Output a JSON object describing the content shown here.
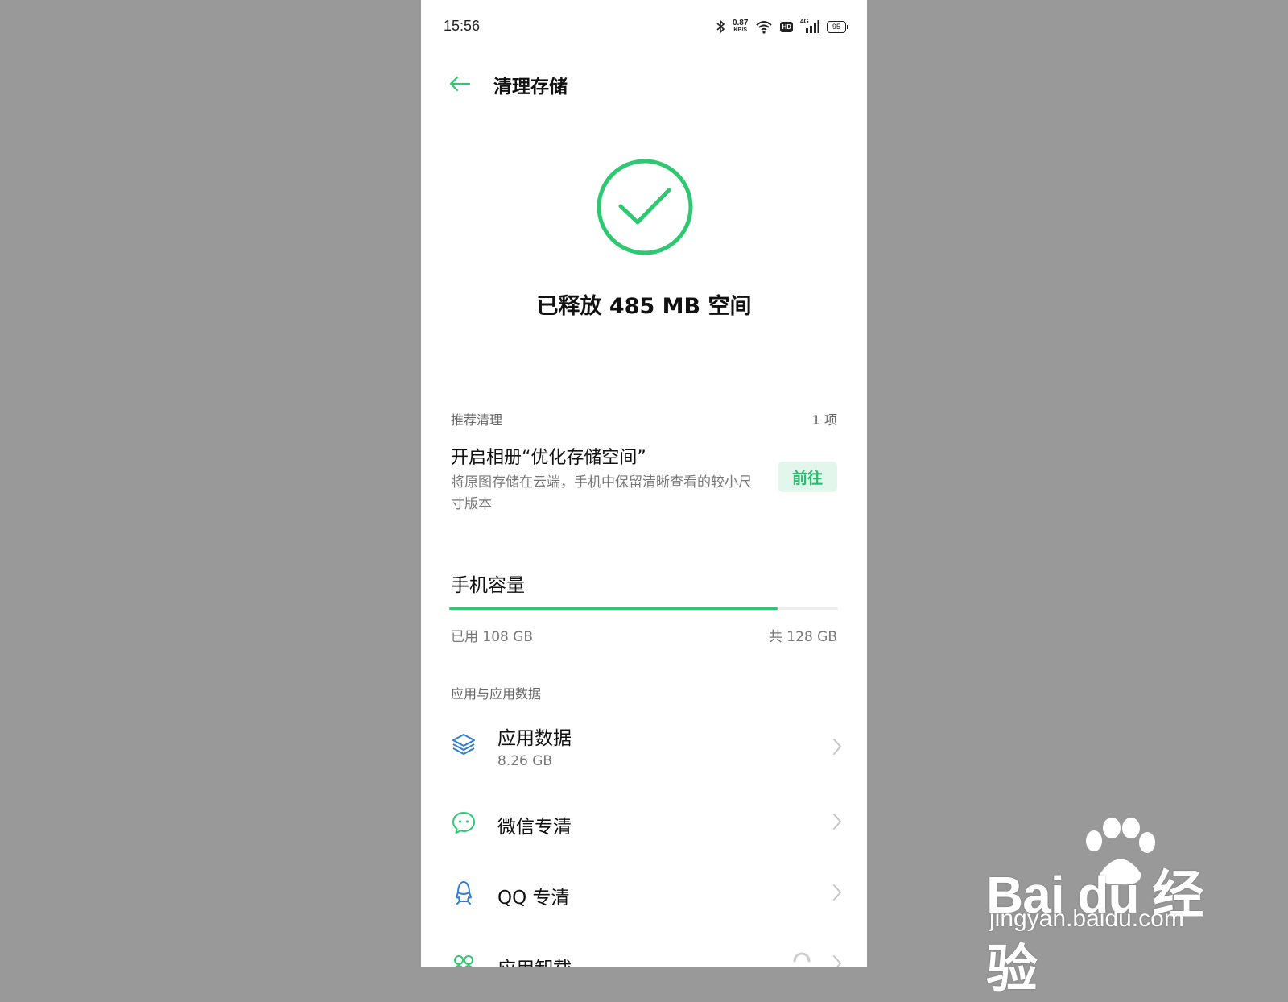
{
  "status_bar": {
    "time": "15:56",
    "net_speed_value": "0.87",
    "net_speed_unit": "KB/S",
    "hd_label": "HD",
    "network_type": "4G",
    "battery": "95",
    "icons": [
      "bluetooth-icon",
      "wifi-icon",
      "hd-icon",
      "signal-4g-icon",
      "battery-icon"
    ]
  },
  "header": {
    "back_icon": "back-arrow-icon",
    "title": "清理存储"
  },
  "result": {
    "icon": "check-circle-icon",
    "message": "已释放 485 MB 空间"
  },
  "recommendation": {
    "section_label": "推荐清理",
    "count": "1 项",
    "title": "开启相册“优化存储空间”",
    "description": "将原图存储在云端，手机中保留清晰查看的较小尺寸版本",
    "action_label": "前往"
  },
  "capacity": {
    "title": "手机容量",
    "used_label": "已用 108 GB",
    "total_label": "共 128 GB",
    "used_gb": 108,
    "total_gb": 128
  },
  "apps_section": {
    "label": "应用与应用数据",
    "items": [
      {
        "icon": "layers-icon",
        "label": "应用数据",
        "sub": "8.26 GB"
      },
      {
        "icon": "wechat-icon",
        "label": "微信专清"
      },
      {
        "icon": "qq-icon",
        "label": "QQ 专清"
      },
      {
        "icon": "app-uninstall-icon",
        "label": "应用卸载"
      }
    ]
  },
  "watermark": {
    "brand": "Bai du 经验",
    "url": "jingyan.baidu.com"
  },
  "colors": {
    "accent": "#2ec872",
    "accent_bg": "#e3f6ec",
    "icon_blue": "#2f7fd6",
    "page_bg": "#999999"
  }
}
